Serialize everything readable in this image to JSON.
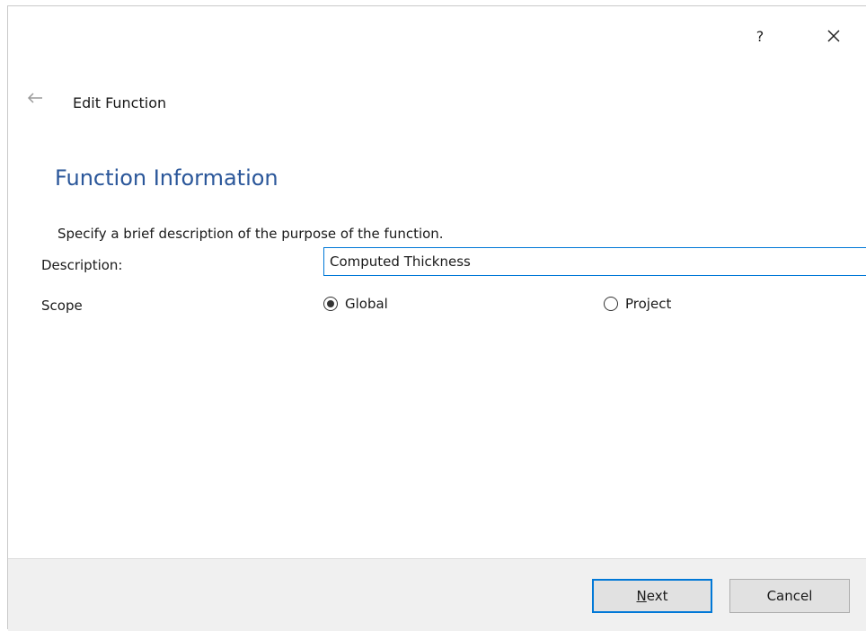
{
  "window": {
    "help_label": "?",
    "close_icon": "close-icon"
  },
  "header": {
    "back_icon": "arrow-left-icon",
    "title": "Edit Function"
  },
  "section": {
    "title": "Function Information",
    "instructions": "Specify a brief description of the purpose of the function."
  },
  "form": {
    "description_label": "Description:",
    "description_value": "Computed Thickness",
    "scope_label": "Scope",
    "scope_options": [
      {
        "label": "Global",
        "selected": true
      },
      {
        "label": "Project",
        "selected": false
      }
    ]
  },
  "footer": {
    "next_label_mnemonic": "N",
    "next_label_rest": "ext",
    "cancel_label": "Cancel"
  },
  "colors": {
    "accent": "#0078d7",
    "section_title": "#2b579a",
    "footer_bg": "#f0f0f0"
  }
}
